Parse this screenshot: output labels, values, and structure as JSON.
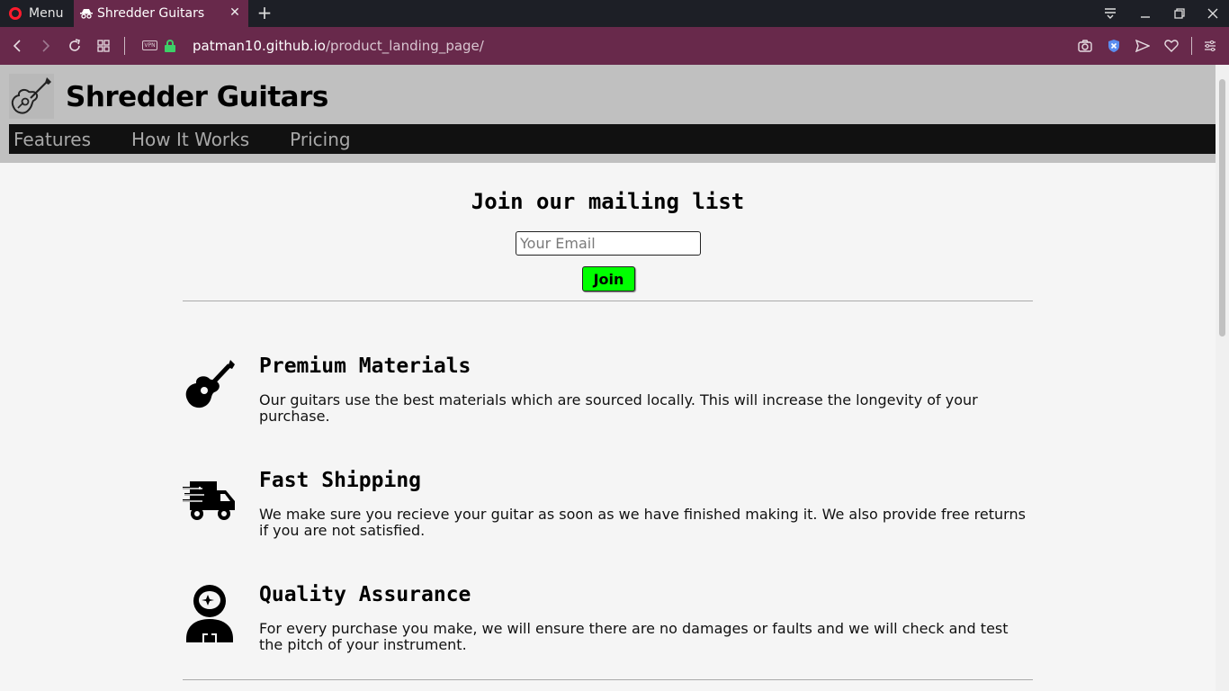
{
  "browser": {
    "menu_label": "Menu",
    "tab_title": "Shredder Guitars",
    "url_host": "patman10.github.io",
    "url_path": "/product_landing_page/",
    "vpn_label": "VPN"
  },
  "header": {
    "brand": "Shredder Guitars",
    "nav": [
      "Features",
      "How It Works",
      "Pricing"
    ]
  },
  "signup": {
    "title": "Join our mailing list",
    "email_placeholder": "Your Email",
    "email_value": "",
    "join_label": "Join"
  },
  "features": [
    {
      "icon": "guitar-icon",
      "title": "Premium Materials",
      "text": "Our guitars use the best materials which are sourced locally. This will increase the longevity of your purchase."
    },
    {
      "icon": "truck-fast-icon",
      "title": "Fast Shipping",
      "text": "We make sure you recieve your guitar as soon as we have finished making it. We also provide free returns if you are not satisfied."
    },
    {
      "icon": "astronaut-icon",
      "title": "Quality Assurance",
      "text": "For every purchase you make, we will ensure there are no damages or faults and we will check and test the pitch of your instrument."
    }
  ],
  "colors": {
    "chrome_tab_active": "#68294b",
    "tabbar": "#1d1f26",
    "header_bg": "#c0c0c0",
    "nav_bg": "#111111",
    "join_button": "#00ff00"
  }
}
